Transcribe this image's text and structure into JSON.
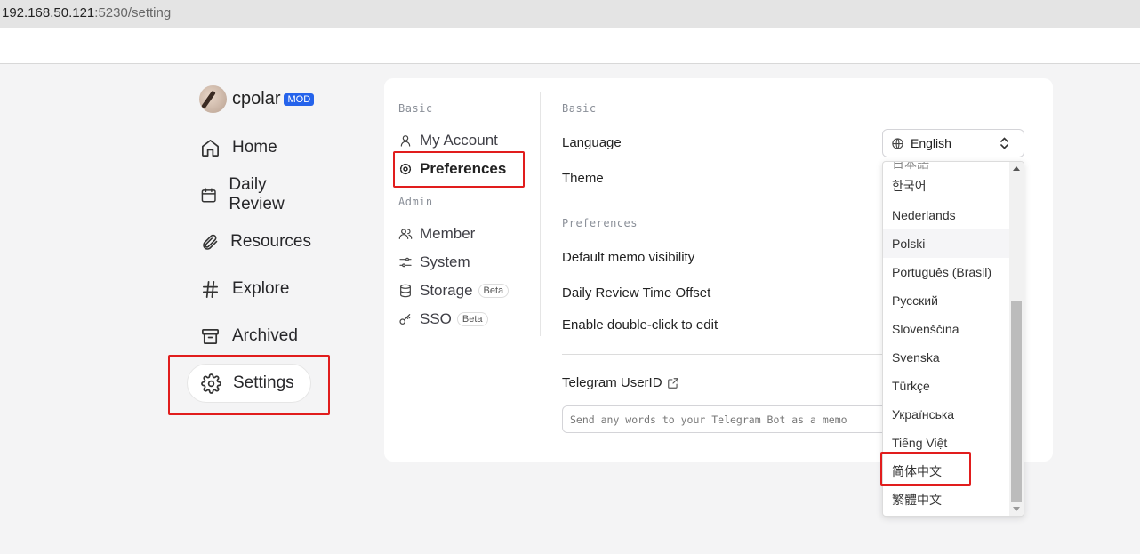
{
  "browser": {
    "url_host": "192.168.50.121",
    "url_rest": ":5230/setting"
  },
  "user": {
    "name": "cpolar",
    "badge": "MOD"
  },
  "nav": {
    "home": "Home",
    "daily_review": "Daily Review",
    "resources": "Resources",
    "explore": "Explore",
    "archived": "Archived",
    "settings": "Settings"
  },
  "settings_sidebar": {
    "basic_heading": "Basic",
    "my_account": "My Account",
    "preferences": "Preferences",
    "admin_heading": "Admin",
    "member": "Member",
    "system": "System",
    "storage": "Storage",
    "sso": "SSO",
    "beta": "Beta"
  },
  "main": {
    "basic_heading": "Basic",
    "language_label": "Language",
    "theme_label": "Theme",
    "preferences_heading": "Preferences",
    "default_visibility_label": "Default memo visibility",
    "daily_review_offset_label": "Daily Review Time Offset",
    "double_click_label": "Enable double-click to edit",
    "telegram_label": "Telegram UserID",
    "telegram_placeholder": "Send any words to your Telegram Bot as a memo"
  },
  "language_select": {
    "selected": "English",
    "options": [
      "한국어",
      "Nederlands",
      "Polski",
      "Português (Brasil)",
      "Русский",
      "Slovenščina",
      "Svenska",
      "Türkçe",
      "Українська",
      "Tiếng Việt",
      "简体中文",
      "繁體中文"
    ],
    "hovered_option": "Polski",
    "highlighted_option": "简体中文"
  },
  "colors": {
    "accent": "#2563eb",
    "highlight_box": "#e11d1d",
    "background": "#f4f4f5"
  }
}
